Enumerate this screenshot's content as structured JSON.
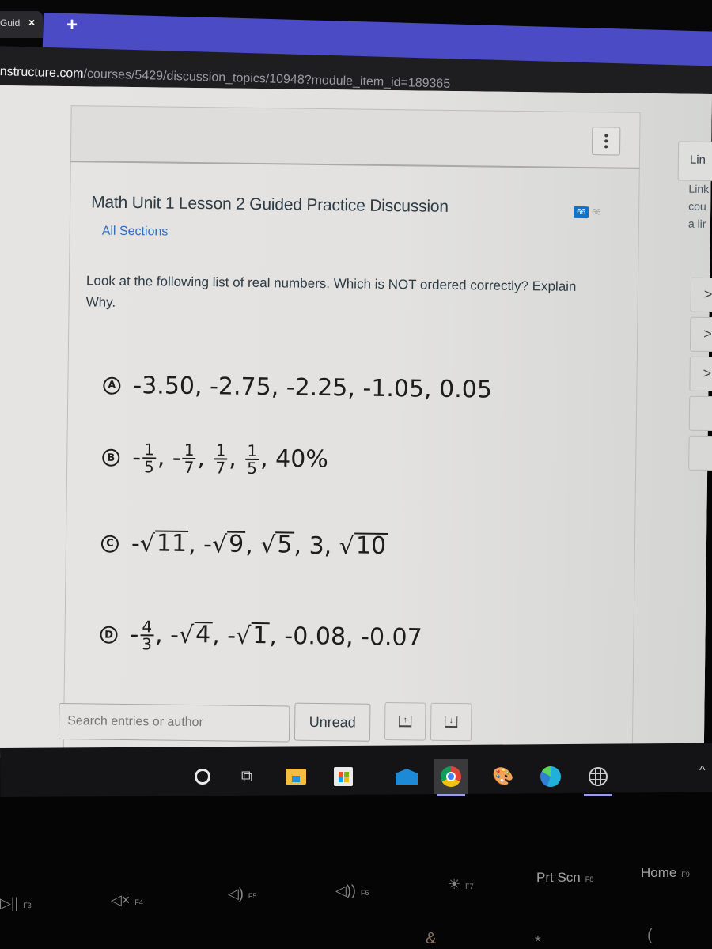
{
  "browser": {
    "tab": {
      "title": "Guid",
      "close_icon": "×"
    },
    "new_tab_icon": "+",
    "url": {
      "domain": "nstructure.com",
      "path": "/courses/5429/discussion_topics/10948?module_item_id=189365"
    }
  },
  "discussion": {
    "title": "Math Unit 1 Lesson 2 Guided Practice Discussion",
    "sections_link": "All Sections",
    "unread_count": "66",
    "total_count": "66",
    "prompt": "Look at the following list of real numbers. Which is NOT ordered correctly? Explain Why.",
    "choices": [
      {
        "letter": "A",
        "parts": [
          "-3.50, -2.75, -2.25, -1.05, 0.05"
        ]
      },
      {
        "letter": "B",
        "parts": [
          {
            "sign": "-",
            "num": "1",
            "den": "5"
          },
          {
            "sign": "-",
            "num": "1",
            "den": "7"
          },
          {
            "sign": "",
            "num": "1",
            "den": "7"
          },
          {
            "sign": "",
            "num": "1",
            "den": "5"
          },
          "40%"
        ]
      },
      {
        "letter": "C",
        "parts": [
          {
            "sign": "-",
            "sqrt": "11"
          },
          {
            "sign": "-",
            "sqrt": "9"
          },
          {
            "sign": "",
            "sqrt": "5"
          },
          "3",
          {
            "sign": "",
            "sqrt": "10"
          }
        ]
      },
      {
        "letter": "D",
        "parts": [
          {
            "sign": "-",
            "num": "4",
            "den": "3"
          },
          {
            "sign": "-",
            "sqrt": "4"
          },
          {
            "sign": "-",
            "sqrt": "1"
          },
          "-0.08",
          "-0.07"
        ]
      }
    ],
    "search_placeholder": "Search entries or author",
    "unread_button": "Unread",
    "collapse_icon": "↑",
    "expand_icon": "↓"
  },
  "sidebar": {
    "link_button": "Lin",
    "description_lines": [
      "Link",
      "cou",
      "a lir"
    ],
    "arrows": [
      ">",
      ">",
      ">",
      "",
      ""
    ]
  },
  "taskbar": {
    "items": [
      "cortana-search",
      "task-view",
      "file-explorer",
      "microsoft-store",
      "mail",
      "google-chrome",
      "paint",
      "microsoft-edge",
      "globe-app"
    ],
    "active": "google-chrome",
    "tray_icon": "^"
  },
  "keyboard": {
    "function_keys": [
      {
        "sym": "▷||",
        "label": "F3"
      },
      {
        "sym": "◁×",
        "label": "F4"
      },
      {
        "sym": "◁)",
        "label": "F5"
      },
      {
        "sym": "◁))",
        "label": "F6"
      },
      {
        "sym": "☀",
        "label": "F7"
      },
      {
        "sym": "Prt Scn",
        "label": "F8"
      },
      {
        "sym": "Home",
        "label": "F9"
      }
    ],
    "row_symbols": [
      "&",
      "*",
      "("
    ]
  }
}
